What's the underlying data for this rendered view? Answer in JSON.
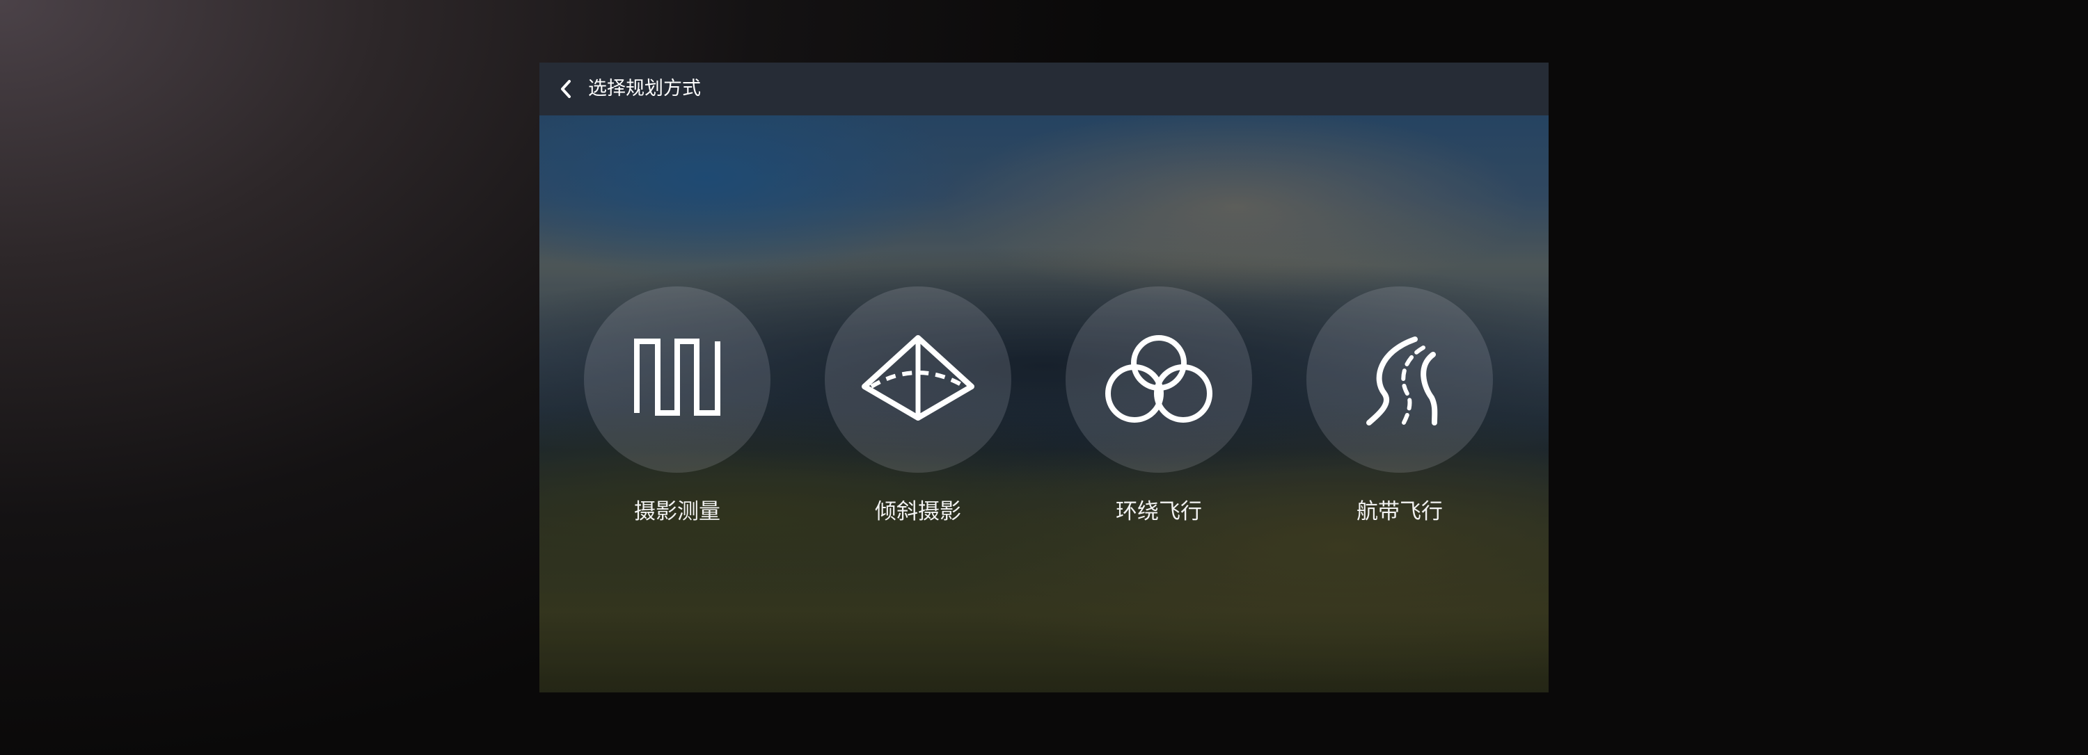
{
  "header": {
    "back_icon": "chevron-left-icon",
    "title": "选择规划方式"
  },
  "options": [
    {
      "label": "摄影测量",
      "icon": "zigzag-path-icon"
    },
    {
      "label": "倾斜摄影",
      "icon": "pyramid-icon"
    },
    {
      "label": "环绕飞行",
      "icon": "three-rings-icon"
    },
    {
      "label": "航带飞行",
      "icon": "road-icon"
    }
  ],
  "colors": {
    "titlebar_bg": "#262c36",
    "text": "#ffffff",
    "icon_stroke": "#ffffff"
  }
}
